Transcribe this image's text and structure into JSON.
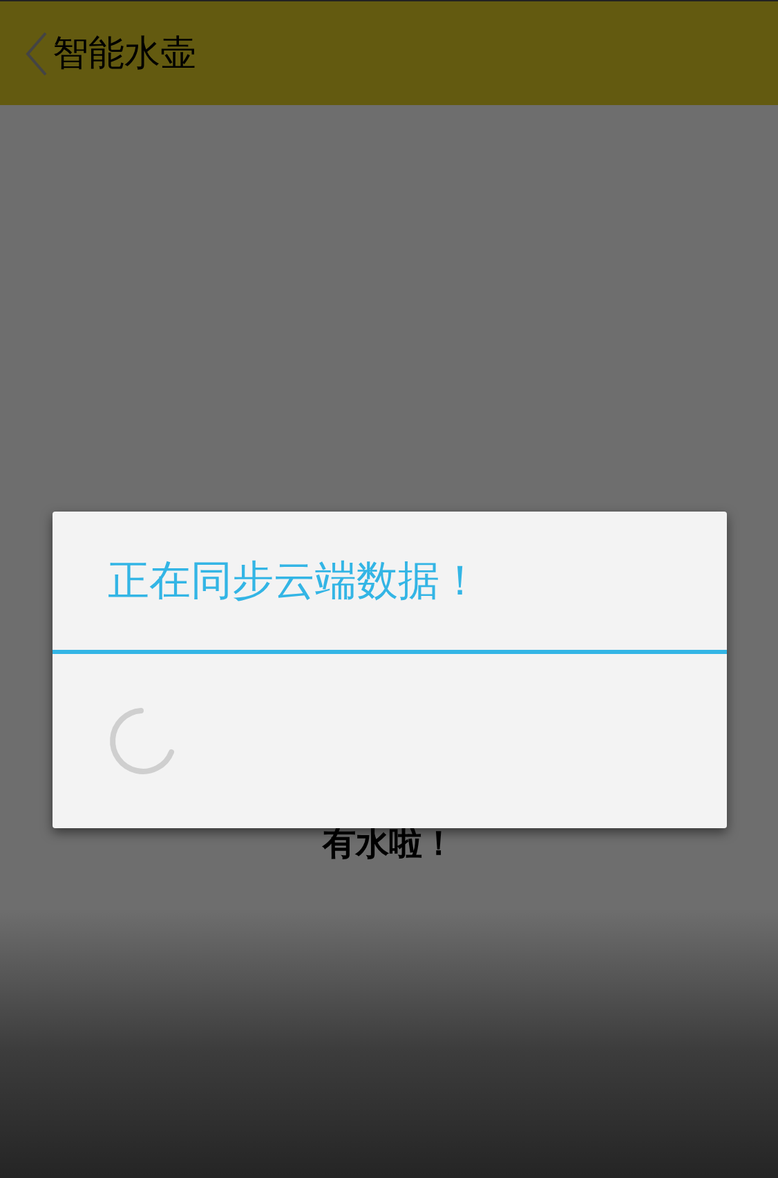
{
  "app_bar": {
    "title": "智能水壶"
  },
  "content": {
    "message": "有水啦！"
  },
  "dialog": {
    "title": "正在同步云端数据！",
    "loading": true
  }
}
